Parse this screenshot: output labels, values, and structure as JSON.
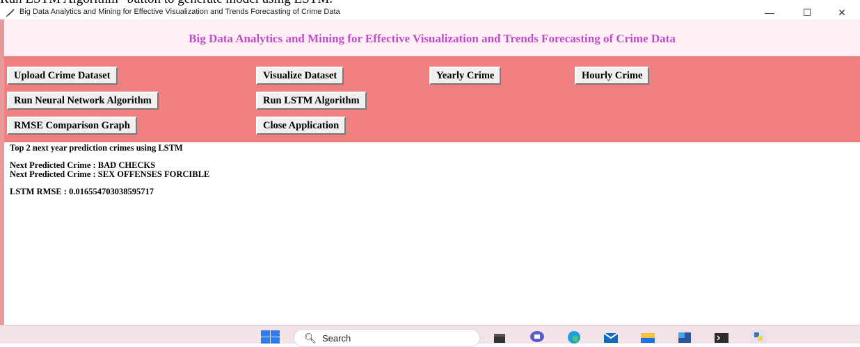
{
  "document_caption": "Run LSTM Algorithm\" button to generate model using LSTM.",
  "window": {
    "title": "Big Data Analytics and Mining for Effective Visualization and Trends Forecasting of Crime Data",
    "controls": {
      "minimize": "—",
      "maximize": "☐",
      "close": "✕"
    }
  },
  "header": {
    "heading": "Big Data Analytics and Mining for Effective Visualization and Trends Forecasting of Crime Data",
    "heading_color": "#c04ccb",
    "background": "#fff0f5"
  },
  "toolbar": {
    "background": "#f08080",
    "buttons": [
      "Upload Crime Dataset",
      "Visualize Dataset",
      "Yearly Crime",
      "Hourly Crime",
      "Run Neural Network Algorithm",
      "Run LSTM Algorithm",
      "RMSE Comparison Graph",
      "Close Application"
    ]
  },
  "output": {
    "lines": [
      "Top 2 next year prediction crimes using LSTM",
      "Next Predicted Crime : BAD CHECKS",
      "Next Predicted Crime : SEX OFFENSES FORCIBLE",
      "LSTM RMSE : 0.016554703038595717"
    ]
  },
  "taskbar": {
    "search_placeholder": "Search",
    "icons": [
      "windows-start-icon",
      "file-explorer-icon",
      "chat-icon",
      "edge-browser-icon",
      "mail-icon",
      "folder-icon",
      "word-icon",
      "terminal-icon",
      "python-icon"
    ]
  }
}
